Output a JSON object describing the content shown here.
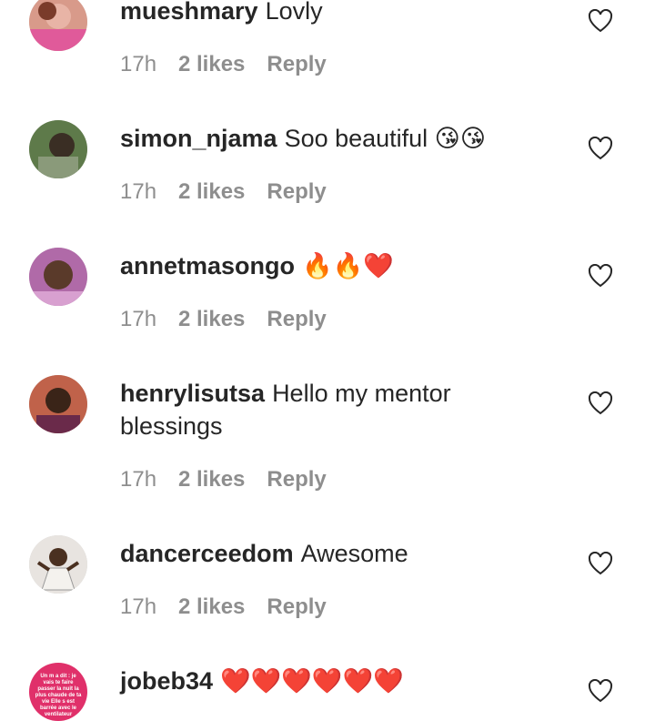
{
  "comments": [
    {
      "username": "mueshmary",
      "text": "Lovly",
      "time": "17h",
      "likes": "2 likes",
      "reply": "Reply"
    },
    {
      "username": "simon_njama",
      "text": "Soo beautiful 😘😘",
      "time": "17h",
      "likes": "2 likes",
      "reply": "Reply"
    },
    {
      "username": "annetmasongo",
      "text": "🔥🔥❤️",
      "time": "17h",
      "likes": "2 likes",
      "reply": "Reply"
    },
    {
      "username": "henrylisutsa",
      "text": "Hello my mentor blessings",
      "time": "17h",
      "likes": "2 likes",
      "reply": "Reply"
    },
    {
      "username": "dancerceedom",
      "text": "Awesome",
      "time": "17h",
      "likes": "2 likes",
      "reply": "Reply"
    },
    {
      "username": "jobeb34",
      "text": "❤️❤️❤️❤️❤️❤️",
      "time": "",
      "likes": "",
      "reply": ""
    }
  ],
  "avatar_story_text": "Un m a dit : je vais te faire passer la nuit la plus chaude de ta vie Elle s est barrée avec le ventilateur",
  "icons": {
    "like": "heart-outline-icon"
  }
}
